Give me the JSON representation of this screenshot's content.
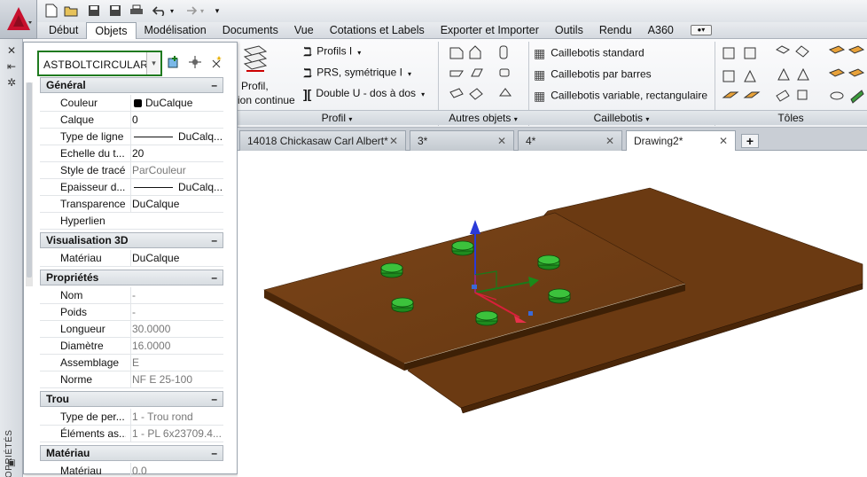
{
  "menu": {
    "items": [
      "Début",
      "Objets",
      "Modélisation",
      "Documents",
      "Vue",
      "Cotations et Labels",
      "Exporter et Importer",
      "Outils",
      "Rendu",
      "A360"
    ],
    "active_index": 1
  },
  "ribbon": {
    "profil_button": {
      "line1": "Profil,",
      "line2": "ion continue"
    },
    "profil_items": [
      "Profils I",
      "PRS, symétrique I",
      "Double U - dos à dos"
    ],
    "caillebotis_items": [
      "Caillebotis standard",
      "Caillebotis par barres",
      "Caillebotis variable, rectangulaire"
    ],
    "panels": {
      "profil": "Profil",
      "autres": "Autres objets",
      "caillebotis": "Caillebotis",
      "toles": "Tôles"
    }
  },
  "palette": {
    "vertical_label": "PROPRIÉTÉS",
    "object_type": "ASTBOLTCIRCULAR",
    "sections": [
      {
        "title": "Général",
        "rows": [
          {
            "k": "Couleur",
            "v": "DuCalque",
            "swatch": true
          },
          {
            "k": "Calque",
            "v": "0"
          },
          {
            "k": "Type de ligne",
            "v": "DuCalq...",
            "line": true
          },
          {
            "k": "Echelle du t...",
            "v": "20"
          },
          {
            "k": "Style de tracé",
            "v": "ParCouleur",
            "gray": true
          },
          {
            "k": "Epaisseur d...",
            "v": "DuCalq...",
            "line": true
          },
          {
            "k": "Transparence",
            "v": "DuCalque"
          },
          {
            "k": "Hyperlien",
            "v": ""
          }
        ]
      },
      {
        "title": "Visualisation 3D",
        "rows": [
          {
            "k": "Matériau",
            "v": "DuCalque"
          }
        ]
      },
      {
        "title": "Propriétés",
        "rows": [
          {
            "k": "Nom",
            "v": "-",
            "gray": true
          },
          {
            "k": "Poids",
            "v": "-",
            "gray": true
          },
          {
            "k": "Longueur",
            "v": "30.0000",
            "gray": true
          },
          {
            "k": "Diamètre",
            "v": "16.0000",
            "gray": true
          },
          {
            "k": "Assemblage",
            "v": "E",
            "gray": true
          },
          {
            "k": "Norme",
            "v": "NF E 25-100",
            "gray": true
          }
        ]
      },
      {
        "title": "Trou",
        "rows": [
          {
            "k": "Type de per...",
            "v": "1 - Trou rond",
            "gray": true
          },
          {
            "k": "Éléments as...",
            "v": "1 - PL  6x23709.4...",
            "gray": true
          }
        ]
      },
      {
        "title": "Matériau",
        "rows": [
          {
            "k": "Matériau",
            "v": "0.0",
            "gray": true
          }
        ]
      }
    ]
  },
  "doc_tabs": [
    "14018 Chickasaw Carl Albert*",
    "3*",
    "4*",
    "Drawing2*"
  ],
  "active_doc": 3,
  "colors": {
    "plate": "#6e3d14",
    "bolt": "#22b022",
    "selection_border": "#1f7a1f"
  }
}
